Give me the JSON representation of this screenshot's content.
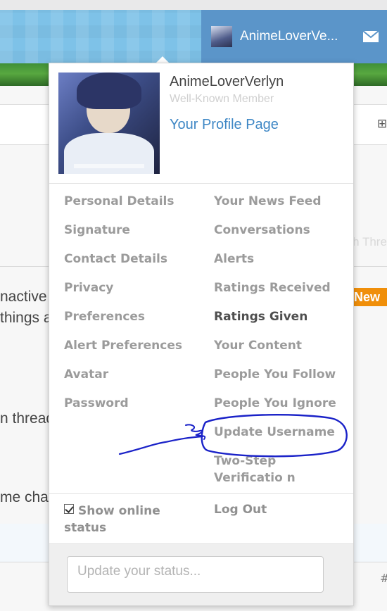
{
  "header": {
    "username": "AnimeLoverVe...",
    "mail_icon": "envelope-icon"
  },
  "background": {
    "watch_thread": "Watch Thre",
    "new_badge": "New",
    "lines": [
      "nactive for almost a whole year because of",
      "things and it might coming",
      "n thread for this within the m",
      "me change this on the brawl site?"
    ],
    "corner_symbol": "#"
  },
  "popup": {
    "username": "AnimeLoverVerlyn",
    "member_title": "Well-Known Member",
    "profile_link": "Your Profile Page",
    "left_menu": [
      {
        "label": "Personal Details"
      },
      {
        "label": "Signature"
      },
      {
        "label": "Contact Details"
      },
      {
        "label": "Privacy"
      },
      {
        "label": "Preferences"
      },
      {
        "label": "Alert Preferences"
      },
      {
        "label": "Avatar"
      },
      {
        "label": "Password"
      }
    ],
    "right_menu": [
      {
        "label": "Your News Feed"
      },
      {
        "label": "Conversations"
      },
      {
        "label": "Alerts"
      },
      {
        "label": "Ratings Received"
      },
      {
        "label": "Ratings Given"
      },
      {
        "label": "Your Content"
      },
      {
        "label": "People You Follow"
      },
      {
        "label": "People You Ignore"
      },
      {
        "label": "Update Username"
      },
      {
        "label": "Two-Step Verificatio n"
      }
    ],
    "show_online_status": "Show online status",
    "show_online_checked": true,
    "logout": "Log Out",
    "status_placeholder": "Update your status..."
  },
  "colors": {
    "accent": "#3e87c5",
    "tab_blue": "#5b95c9",
    "annotation": "#1a22c8",
    "new_badge": "#f08f0a"
  }
}
